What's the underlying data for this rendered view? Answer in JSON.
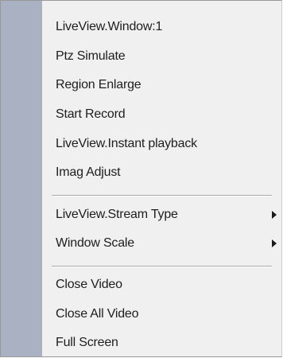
{
  "context_menu": {
    "items": [
      {
        "label": "LiveView.Window:1"
      },
      {
        "label": "Ptz Simulate"
      },
      {
        "label": "Region Enlarge"
      },
      {
        "label": "Start Record"
      },
      {
        "label": "LiveView.Instant playback"
      },
      {
        "label": "Imag Adjust"
      },
      {
        "label": "LiveView.Stream Type",
        "submenu_icon": "chevron-right-icon"
      },
      {
        "label": "Window Scale",
        "submenu_icon": "chevron-right-icon"
      },
      {
        "label": "Close Video"
      },
      {
        "label": "Close All Video"
      },
      {
        "label": "Full Screen"
      }
    ]
  },
  "colors": {
    "menu_background": "#f0f0f0",
    "gutter": "#aab1c3",
    "text": "#1e1e1e",
    "separator": "#a9a9a9"
  }
}
